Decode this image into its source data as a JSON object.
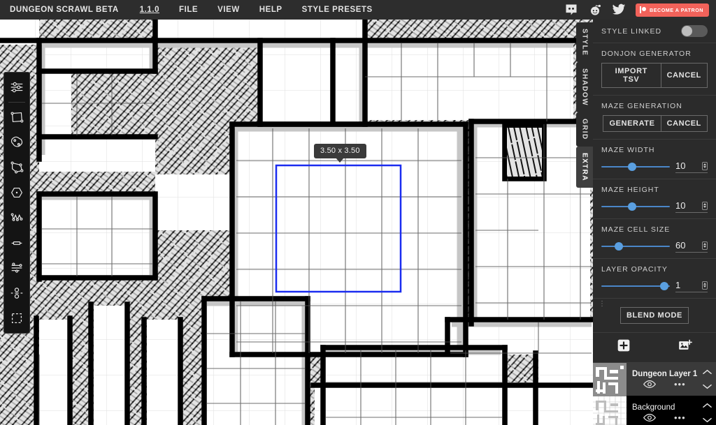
{
  "topbar": {
    "brand": "DUNGEON SCRAWL BETA",
    "version": "1.1.0",
    "menus": [
      "FILE",
      "VIEW",
      "HELP",
      "STYLE PRESETS"
    ],
    "social": [
      {
        "name": "discord-icon",
        "label": "Discord"
      },
      {
        "name": "reddit-icon",
        "label": "Reddit"
      },
      {
        "name": "twitter-icon",
        "label": "Twitter"
      }
    ],
    "patron_label": "BECOME A PATRON",
    "patron_color": "#f2625a"
  },
  "toolbar": {
    "tools": [
      {
        "name": "settings-sliders-tool",
        "label": "Settings"
      },
      {
        "name": "rectangle-room-tool",
        "label": "Rectangle room"
      },
      {
        "name": "freeform-blob-tool",
        "label": "Freeform blob"
      },
      {
        "name": "polygon-room-tool",
        "label": "Polygon room"
      },
      {
        "name": "hexagon-room-tool",
        "label": "Hexagon room"
      },
      {
        "name": "corridor-path-tool",
        "label": "Corridor path"
      },
      {
        "name": "door-tool",
        "label": "Door"
      },
      {
        "name": "stairs-tool",
        "label": "Stairs"
      },
      {
        "name": "pillar-tool",
        "label": "Pillar"
      },
      {
        "name": "select-tool",
        "label": "Select"
      }
    ]
  },
  "canvas": {
    "dimension_tooltip": "3.50 x 3.50",
    "selection_color": "#1a2cf0",
    "grid_color": "#d9d9d9",
    "wall_color": "#000000",
    "shadow_color": "#cfcfcf",
    "floor_color": "#ffffff"
  },
  "vertical_tabs": [
    {
      "label": "STYLE",
      "active": false
    },
    {
      "label": "SHADOW",
      "active": false
    },
    {
      "label": "GRID",
      "active": false
    },
    {
      "label": "EXTRA",
      "active": true
    }
  ],
  "panel": {
    "style_linked": {
      "label": "STYLE LINKED",
      "value": "off"
    },
    "donjon": {
      "label": "DONJON GENERATOR",
      "import_label": "IMPORT TSV",
      "cancel_label": "CANCEL"
    },
    "maze": {
      "label": "MAZE GENERATION",
      "generate_label": "GENERATE",
      "cancel_label": "CANCEL"
    },
    "sliders": [
      {
        "label": "MAZE WIDTH",
        "value": "10",
        "pct": 45
      },
      {
        "label": "MAZE HEIGHT",
        "value": "10",
        "pct": 45
      },
      {
        "label": "MAZE CELL SIZE",
        "value": "60",
        "pct": 25
      },
      {
        "label": "LAYER OPACITY",
        "value": "1",
        "pct": 92
      }
    ],
    "blend_mode_label": "BLEND MODE",
    "add_layer_label": "+",
    "layers": [
      {
        "name": "Dungeon Layer 1",
        "selected": true,
        "visible": true
      },
      {
        "name": "Background",
        "selected": false,
        "visible": true
      }
    ]
  }
}
